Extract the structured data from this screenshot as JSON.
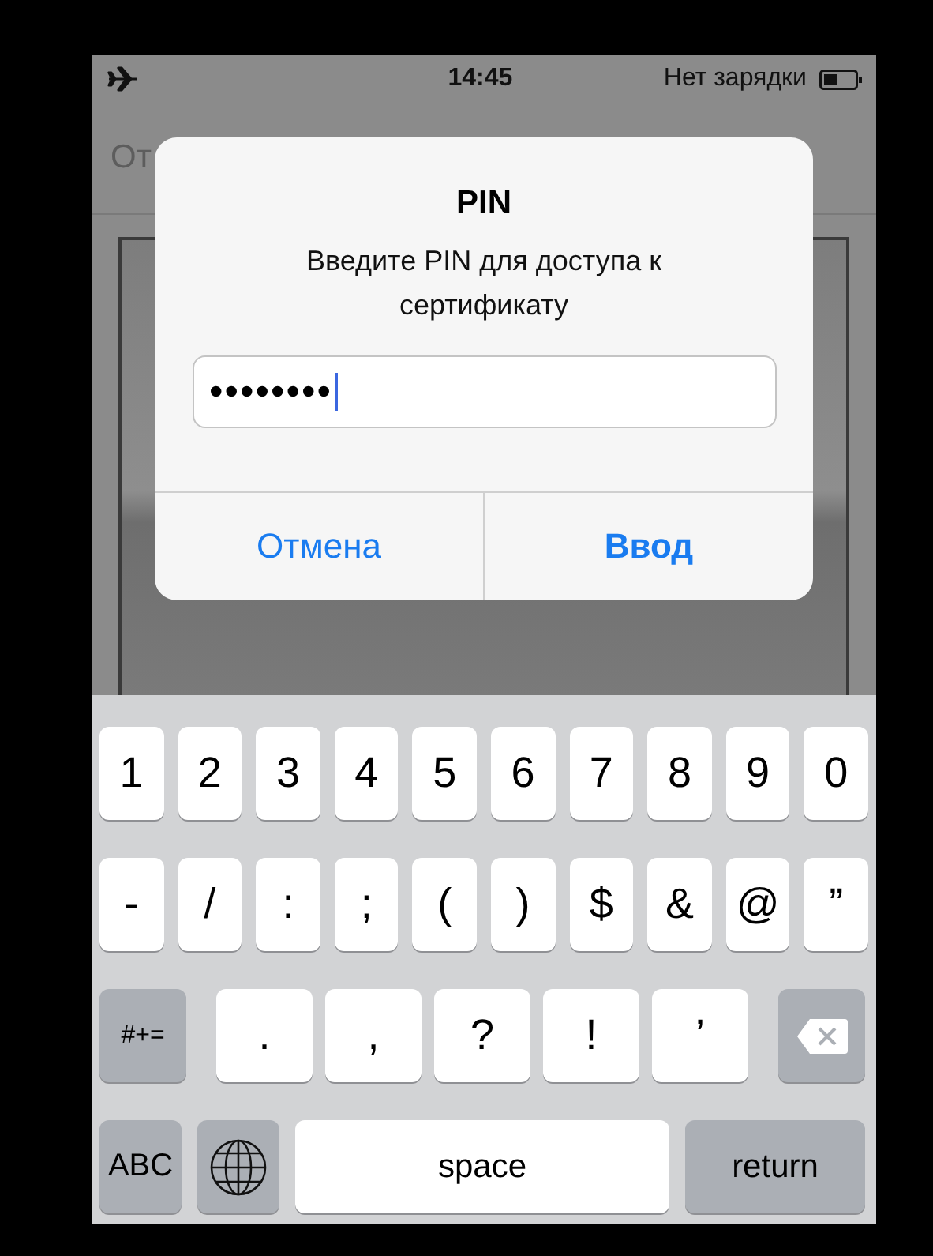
{
  "status_bar": {
    "time": "14:45",
    "carrier_status": "Нет зарядки"
  },
  "nav_bar": {
    "back": "От"
  },
  "alert": {
    "title": "PIN",
    "message": "Введите PIN для доступа к сертификату",
    "field": {
      "value": "••••••••",
      "focused": true
    },
    "buttons": [
      {
        "label": "Отмена",
        "kind": "cancel"
      },
      {
        "label": "Ввод",
        "kind": "default"
      }
    ]
  },
  "keyboard": {
    "number_row": [
      {
        "label": "1",
        "kind": "char"
      },
      {
        "label": "2",
        "kind": "char"
      },
      {
        "label": "3",
        "kind": "char"
      },
      {
        "label": "4",
        "kind": "char"
      },
      {
        "label": "5",
        "kind": "char"
      },
      {
        "label": "6",
        "kind": "char"
      },
      {
        "label": "7",
        "kind": "char"
      },
      {
        "label": "8",
        "kind": "char"
      },
      {
        "label": "9",
        "kind": "char"
      },
      {
        "label": "0",
        "kind": "char"
      }
    ],
    "symbol_row": [
      {
        "label": "-",
        "kind": "char"
      },
      {
        "label": "/",
        "kind": "char"
      },
      {
        "label": ":",
        "kind": "char"
      },
      {
        "label": ";",
        "kind": "char"
      },
      {
        "label": "(",
        "kind": "char"
      },
      {
        "label": ")",
        "kind": "char"
      },
      {
        "label": "$",
        "kind": "char"
      },
      {
        "label": "&",
        "kind": "char"
      },
      {
        "label": "@",
        "kind": "char"
      },
      {
        "label": "”",
        "kind": "char"
      }
    ],
    "punctuation_row": [
      {
        "label": "#+=",
        "kind": "function"
      },
      {
        "label": ".",
        "kind": "char"
      },
      {
        "label": ",",
        "kind": "char"
      },
      {
        "label": "?",
        "kind": "char"
      },
      {
        "label": "!",
        "kind": "char"
      },
      {
        "label": "’",
        "kind": "char"
      },
      {
        "kind": "delete"
      }
    ],
    "bottom_row": [
      {
        "label": "ABC",
        "kind": "function"
      },
      {
        "kind": "globe"
      },
      {
        "label": "space",
        "kind": "space"
      },
      {
        "label": "return",
        "kind": "function"
      }
    ]
  }
}
